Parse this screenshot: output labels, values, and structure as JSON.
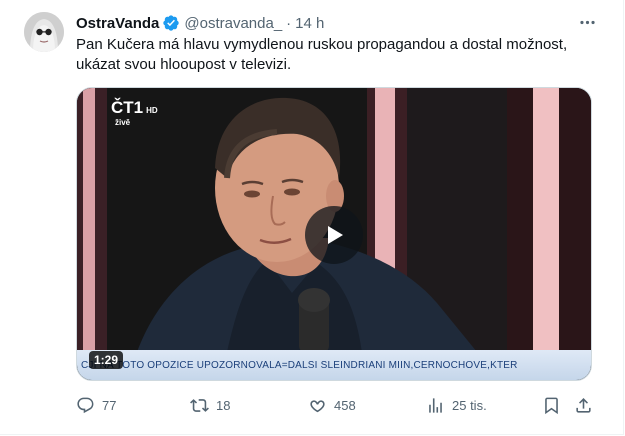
{
  "tweet": {
    "display_name": "OstraVanda",
    "handle": "@ostravanda_",
    "separator": "·",
    "time": "14 h",
    "text": "Pan Kučera má hlavu vymydlenou ruskou propagandou a dostal možnost, ukázat svou hlooupost v televizi.",
    "verified": true,
    "accent_color": "#1d9bf0"
  },
  "media": {
    "channel_logo": "ČT1",
    "channel_hd": "HD",
    "live_label": "živě",
    "duration": "1:29",
    "ticker": "CJI NA TOTO   OPOZICE   UPOZORNOVALA=DALSI   SLEINDRIANI   MIIN,CERNOCHOVE,KTER",
    "play_icon": "play-icon"
  },
  "actions": {
    "replies": {
      "icon": "reply-icon",
      "count": "77"
    },
    "reposts": {
      "icon": "repost-icon",
      "count": "18"
    },
    "likes": {
      "icon": "like-icon",
      "count": "458"
    },
    "views": {
      "icon": "views-icon",
      "count": "25 tis."
    },
    "bookmark": {
      "icon": "bookmark-icon"
    },
    "share": {
      "icon": "share-icon"
    }
  }
}
